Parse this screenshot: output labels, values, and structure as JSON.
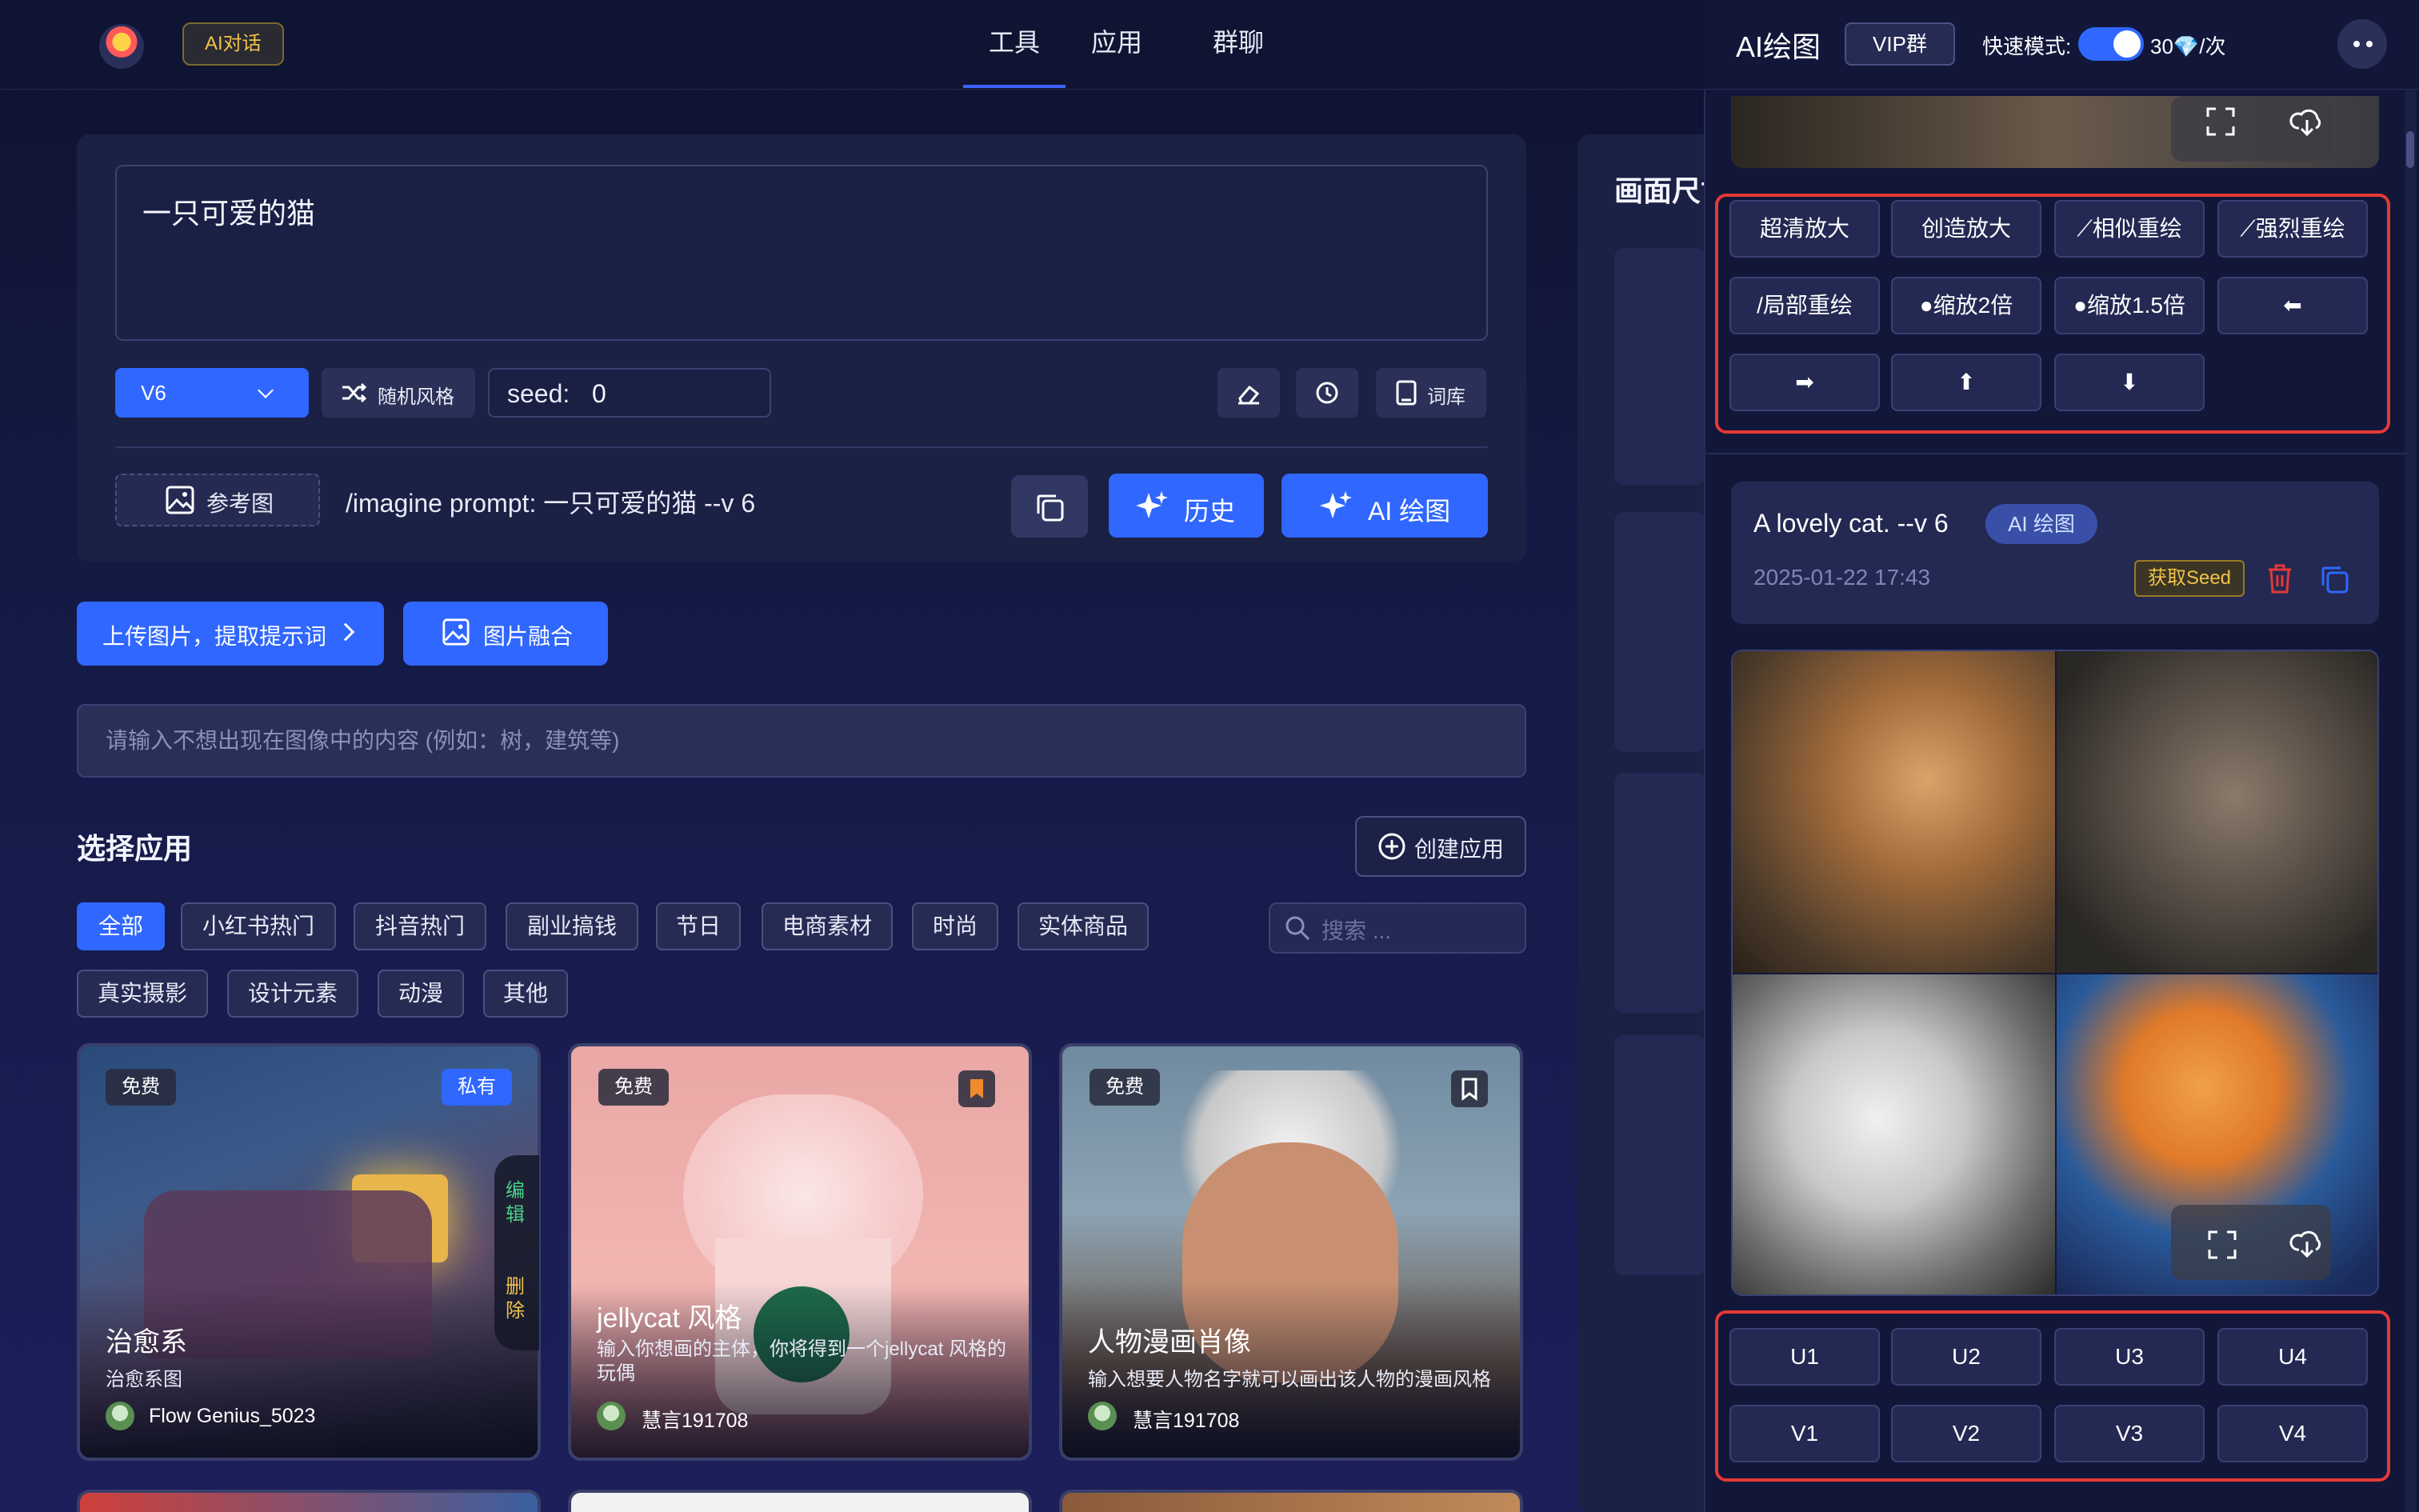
{
  "header": {
    "ai_chat_badge": "AI对话",
    "nav_tabs": [
      "工具",
      "应用",
      "群聊"
    ]
  },
  "prompt": {
    "text": "一只可爱的猫",
    "version": "V6",
    "random_style": "随机风格",
    "seed_label": "seed:",
    "seed_value": "0",
    "lexicon": "词库",
    "reference_image": "参考图",
    "imagine_text": "/imagine prompt: 一只可爱的猫 --v 6",
    "history": "历史",
    "ai_draw": "AI 绘图"
  },
  "actions": {
    "upload": "上传图片，提取提示词",
    "fusion": "图片融合"
  },
  "negative_placeholder": "请输入不想出现在图像中的内容 (例如：树，建筑等)",
  "apps": {
    "section_title": "选择应用",
    "create_app": "创建应用",
    "search_placeholder": "搜索 ...",
    "filters_row1": [
      "全部",
      "小红书热门",
      "抖音热门",
      "副业搞钱",
      "节日",
      "电商素材",
      "时尚",
      "实体商品"
    ],
    "filters_row2": [
      "真实摄影",
      "设计元素",
      "动漫",
      "其他"
    ],
    "cards": [
      {
        "tag": "免费",
        "private": "私有",
        "edit": "编辑",
        "delete": "删除",
        "title": "治愈系",
        "desc": "治愈系图",
        "author": "Flow Genius_5023"
      },
      {
        "tag": "免费",
        "title": "jellycat 风格",
        "desc": "输入你想画的主体，你将得到一个jellycat 风格的玩偶",
        "author": "慧言191708"
      },
      {
        "tag": "免费",
        "title": "人物漫画肖像",
        "desc": "输入想要人物名字就可以画出该人物的漫画风格",
        "author": "慧言191708"
      }
    ]
  },
  "middle": {
    "title": "画面尺寸"
  },
  "right": {
    "title": "AI绘图",
    "vip": "VIP群",
    "fast_mode": "快速模式:",
    "cost": "30💎/次",
    "row1": [
      "超清放大",
      "创造放大",
      "相似重绘",
      "强烈重绘"
    ],
    "row2": [
      "局部重绘",
      "缩放2倍",
      "缩放1.5倍"
    ],
    "job_prompt": "A lovely cat. --v 6",
    "job_tag": "AI 绘图",
    "job_time": "2025-01-22 17:43",
    "get_seed": "获取Seed",
    "u_buttons": [
      "U1",
      "U2",
      "U3",
      "U4"
    ],
    "v_buttons": [
      "V1",
      "V2",
      "V3",
      "V4"
    ]
  },
  "colors": {
    "accent": "#2f67ff",
    "highlight_frame": "#e53935",
    "seed_badge": "#f0c24a"
  }
}
